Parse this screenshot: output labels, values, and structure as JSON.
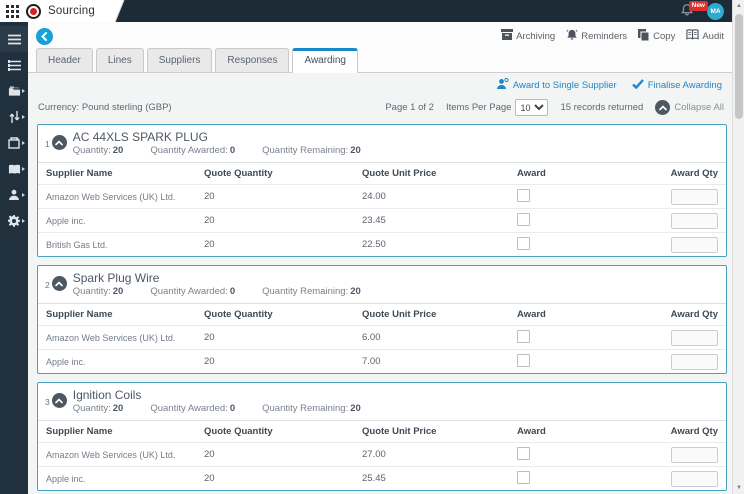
{
  "topbar": {
    "title": "Sourcing",
    "badge": "New",
    "avatar": "MA"
  },
  "sidebar": {
    "icons": [
      "menu-icon",
      "list-icon",
      "folder-icon",
      "sort-arrows-icon",
      "package-icon",
      "contacts-book-icon",
      "user-icon",
      "gear-icon"
    ]
  },
  "toolbar": {
    "items": [
      {
        "label": "Archiving",
        "icon": "archive-icon"
      },
      {
        "label": "Reminders",
        "icon": "bell-icon"
      },
      {
        "label": "Copy",
        "icon": "copy-icon"
      },
      {
        "label": "Audit",
        "icon": "audit-book-icon"
      }
    ]
  },
  "tabs": [
    {
      "label": "Header",
      "active": false
    },
    {
      "label": "Lines",
      "active": false
    },
    {
      "label": "Suppliers",
      "active": false
    },
    {
      "label": "Responses",
      "active": false
    },
    {
      "label": "Awarding",
      "active": true
    }
  ],
  "actions": {
    "award_single": "Award to Single Supplier",
    "finalise": "Finalise Awarding"
  },
  "info_bar": {
    "currency_label": "Currency:",
    "currency_value": "Pound sterling (GBP)",
    "page": "Page 1 of 2",
    "items_per_page_label": "Items Per Page",
    "items_per_page_value": "10",
    "records": "15 records returned",
    "collapse_all": "Collapse All"
  },
  "table": {
    "columns": [
      "Supplier Name",
      "Quote Quantity",
      "Quote Unit Price",
      "Award",
      "Award Qty"
    ]
  },
  "labels": {
    "quantity": "Quantity:",
    "awarded": "Quantity Awarded:",
    "remaining": "Quantity Remaining:"
  },
  "sections": [
    {
      "index": "1",
      "title": "AC 44XLS SPARK PLUG",
      "quantity": "20",
      "awarded": "0",
      "remaining": "20",
      "rows": [
        {
          "supplier": "Amazon Web Services (UK) Ltd.",
          "qty": "20",
          "price": "24.00"
        },
        {
          "supplier": "Apple inc.",
          "qty": "20",
          "price": "23.45"
        },
        {
          "supplier": "British Gas Ltd.",
          "qty": "20",
          "price": "22.50"
        }
      ]
    },
    {
      "index": "2",
      "title": "Spark Plug Wire",
      "quantity": "20",
      "awarded": "0",
      "remaining": "20",
      "rows": [
        {
          "supplier": "Amazon Web Services (UK) Ltd.",
          "qty": "20",
          "price": "6.00"
        },
        {
          "supplier": "Apple inc.",
          "qty": "20",
          "price": "7.00"
        }
      ]
    },
    {
      "index": "3",
      "title": "Ignition Coils",
      "quantity": "20",
      "awarded": "0",
      "remaining": "20",
      "rows": [
        {
          "supplier": "Amazon Web Services (UK) Ltd.",
          "qty": "20",
          "price": "27.00"
        },
        {
          "supplier": "Apple inc.",
          "qty": "20",
          "price": "25.45"
        }
      ]
    }
  ],
  "colors": {
    "topbar": "#1d2b36",
    "sidebar": "#20303d",
    "accent_teal": "#18a0d9",
    "link_blue": "#1e87c9",
    "section_border": "#4aa2c2",
    "badge_red": "#e02f2f"
  }
}
